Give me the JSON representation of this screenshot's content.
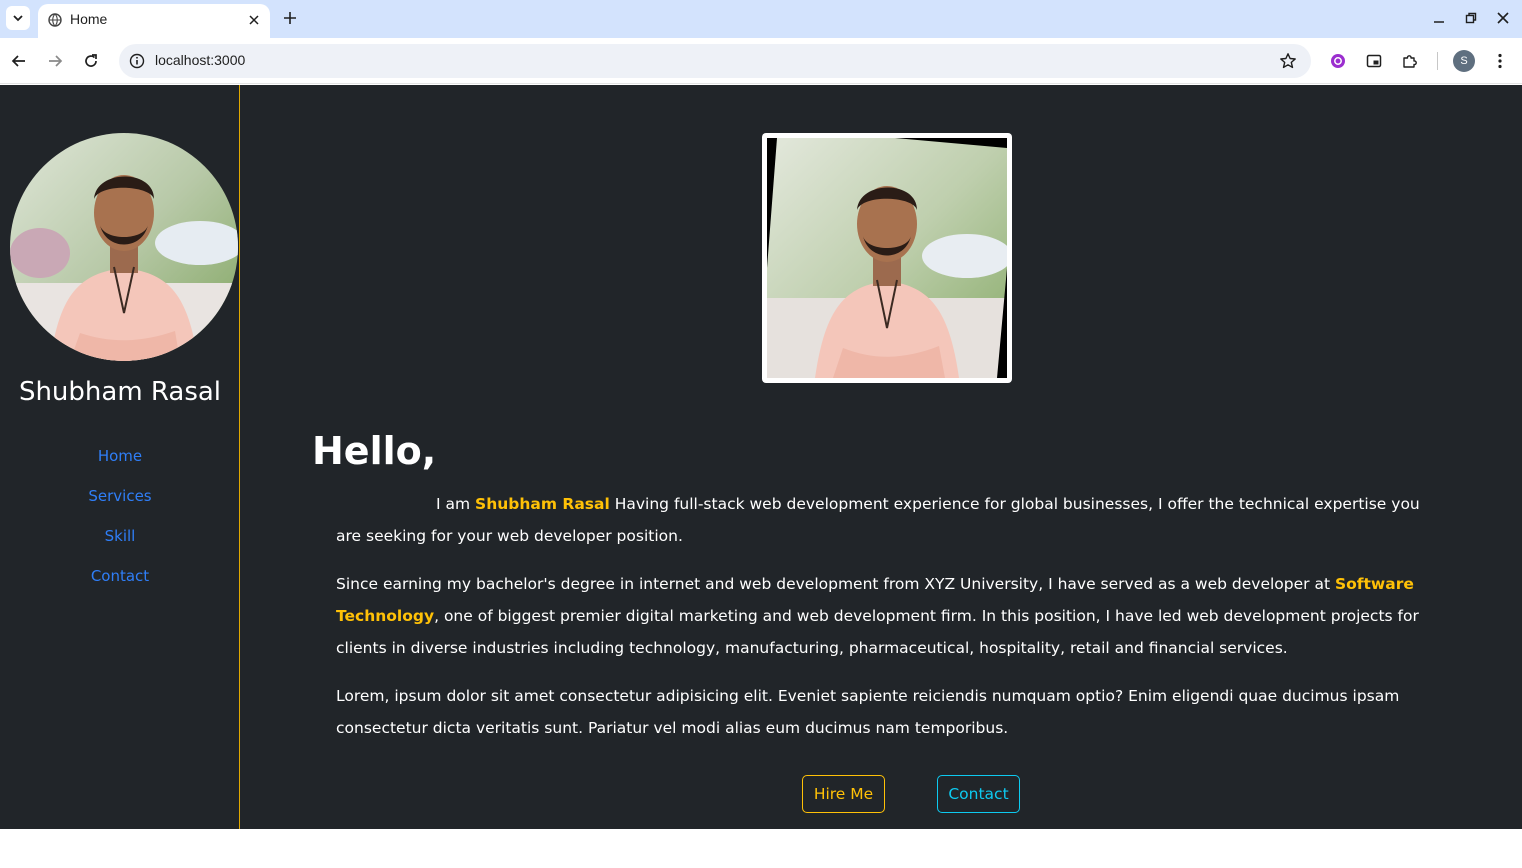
{
  "browser": {
    "tab_title": "Home",
    "url": "localhost:3000",
    "profile_initial": "S",
    "colors": {
      "tabbar": "#d3e3fd",
      "omnibox": "#eef1f7"
    }
  },
  "sidebar": {
    "name": "Shubham Rasal",
    "nav": [
      {
        "label": "Home"
      },
      {
        "label": "Services"
      },
      {
        "label": "Skill"
      },
      {
        "label": "Contact"
      }
    ]
  },
  "main": {
    "greeting": "Hello,",
    "p1_lead": "I am ",
    "p1_name": "Shubham Rasal",
    "p1_rest": " Having full-stack web development experience for global businesses, I offer the technical expertise you are seeking for your web developer position.",
    "p2_lead": "Since earning my bachelor's degree in internet and web development from XYZ University, I have served as a web developer at ",
    "p2_company": "Software Technology",
    "p2_rest": ", one of biggest premier digital marketing and web development firm. In this position, I have led web development projects for clients in diverse industries including technology, manufacturing, pharmaceutical, hospitality, retail and financial services.",
    "p3": "Lorem, ipsum dolor sit amet consectetur adipisicing elit. Eveniet sapiente reiciendis numquam optio? Enim eligendi quae ducimus ipsam consectetur dicta veritatis sunt. Pariatur vel modi alias eum ducimus nam temporibus.",
    "hire_label": "Hire Me",
    "contact_label": "Contact"
  },
  "theme": {
    "page_bg": "#212529",
    "highlight": "#ffc107",
    "link": "#2f7ef7",
    "info": "#0dcaf0"
  }
}
